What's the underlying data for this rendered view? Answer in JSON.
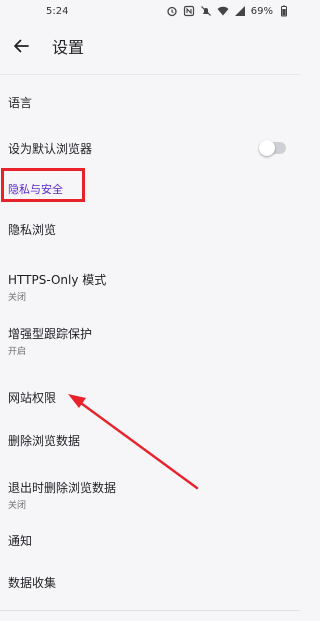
{
  "status_bar": {
    "time": "5:24",
    "battery": "69%"
  },
  "app_bar": {
    "title": "设置"
  },
  "items": [
    {
      "label": "语言"
    },
    {
      "label": "设为默认浏览器",
      "toggle": false
    },
    {
      "section_header": "隐私与安全"
    },
    {
      "label": "隐私浏览"
    },
    {
      "label": "HTTPS-Only 模式",
      "subtitle": "关闭"
    },
    {
      "label": "增强型跟踪保护",
      "subtitle": "开启"
    },
    {
      "label": "网站权限"
    },
    {
      "label": "删除浏览数据"
    },
    {
      "label": "退出时删除浏览数据",
      "subtitle": "关闭"
    },
    {
      "label": "通知"
    },
    {
      "label": "数据收集"
    }
  ],
  "colors": {
    "accent": "#592acb",
    "annotation": "#e8222b"
  }
}
